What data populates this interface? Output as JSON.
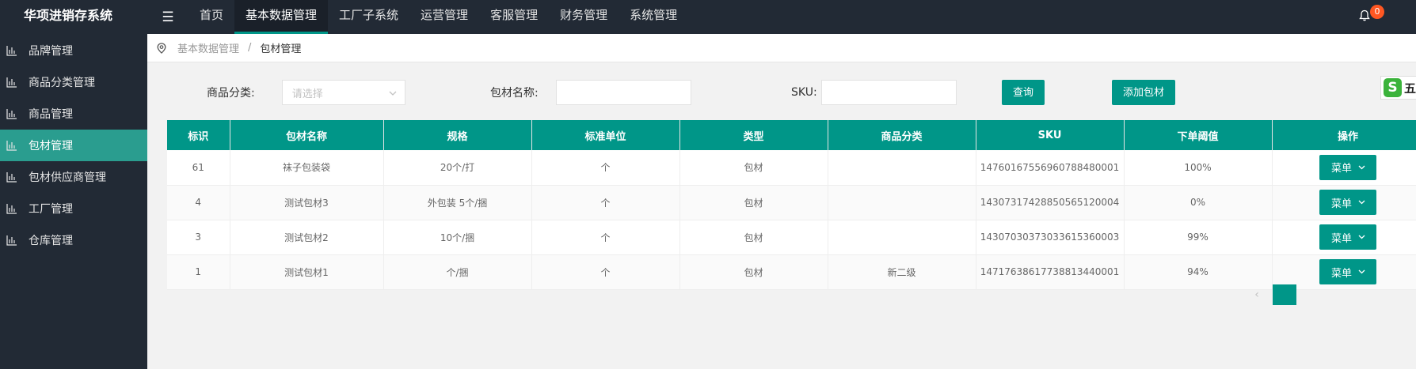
{
  "app": {
    "title": "华项进销存系统"
  },
  "topnav": {
    "menu_icon": "☰",
    "items": [
      "首页",
      "基本数据管理",
      "工厂子系统",
      "运营管理",
      "客服管理",
      "财务管理",
      "系统管理"
    ],
    "active_index": 1
  },
  "notifications": {
    "count": "0",
    "icon": "bell-icon"
  },
  "sidebar": {
    "items": [
      {
        "label": "品牌管理",
        "icon": "bar-chart-icon"
      },
      {
        "label": "商品分类管理",
        "icon": "bar-chart-icon"
      },
      {
        "label": "商品管理",
        "icon": "bar-chart-icon"
      },
      {
        "label": "包材管理",
        "icon": "bar-chart-icon",
        "active": true
      },
      {
        "label": "包材供应商管理",
        "icon": "bar-chart-icon"
      },
      {
        "label": "工厂管理",
        "icon": "bar-chart-icon"
      },
      {
        "label": "仓库管理",
        "icon": "bar-chart-icon"
      }
    ]
  },
  "breadcrumb": {
    "items": [
      "基本数据管理",
      "包材管理"
    ],
    "separator": "/"
  },
  "filters": {
    "category_label": "商品分类:",
    "category_placeholder": "请选择",
    "name_label": "包材名称:",
    "name_value": "",
    "sku_label": "SKU:",
    "sku_value": "",
    "search_button": "查询",
    "add_button": "添加包材"
  },
  "ime": {
    "label": "五"
  },
  "table": {
    "columns": [
      "标识",
      "包材名称",
      "规格",
      "标准单位",
      "类型",
      "商品分类",
      "SKU",
      "下单阈值",
      "操作"
    ],
    "rows": [
      [
        "61",
        "袜子包装袋",
        "20个/打",
        "个",
        "包材",
        "",
        "1476016755696078848000​1",
        "100%"
      ],
      [
        "4",
        "测试包材3",
        "外包装 5个/捆",
        "个",
        "包材",
        "",
        "14307317428850565120004",
        "0%"
      ],
      [
        "3",
        "测试包材2",
        "10个/捆",
        "个",
        "包材",
        "",
        "14307030373033615360003",
        "99%"
      ],
      [
        "1",
        "测试包材1",
        "个/捆",
        "个",
        "包材",
        "新二级",
        "14717638617738813440001",
        "94%"
      ]
    ],
    "action_label": "菜单"
  },
  "pagination": {
    "prev": "‹",
    "current": ""
  }
}
